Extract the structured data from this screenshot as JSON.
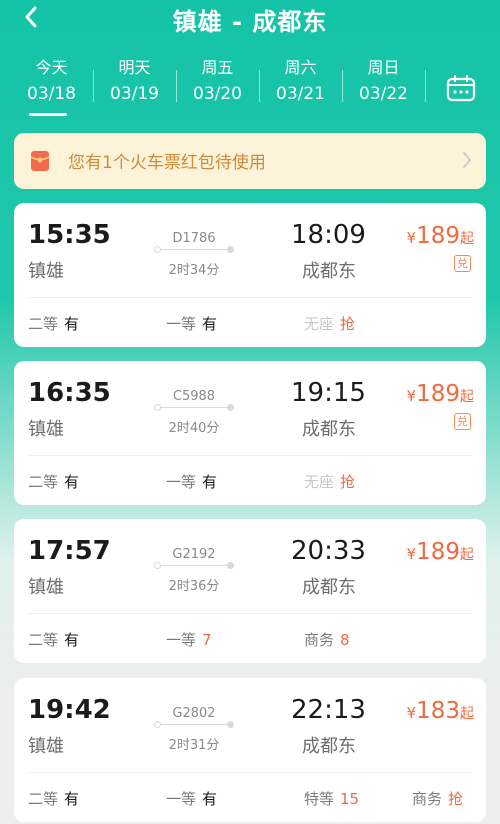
{
  "header": {
    "title": "镇雄 - 成都东",
    "back_icon": "chevron-left-icon",
    "calendar_icon": "calendar-icon"
  },
  "dates": [
    {
      "weekday": "今天",
      "date": "03/18",
      "selected": true
    },
    {
      "weekday": "明天",
      "date": "03/19",
      "selected": false
    },
    {
      "weekday": "周五",
      "date": "03/20",
      "selected": false
    },
    {
      "weekday": "周六",
      "date": "03/21",
      "selected": false
    },
    {
      "weekday": "周日",
      "date": "03/22",
      "selected": false
    }
  ],
  "promo": {
    "text": "您有1个火车票红包待使用",
    "icon": "red-packet-icon"
  },
  "trains": [
    {
      "dep_time": "15:35",
      "dep_station": "镇雄",
      "train_no": "D1786",
      "duration": "2时34分",
      "arr_time": "18:09",
      "arr_station": "成都东",
      "price_symbol": "¥",
      "price": "189",
      "price_suffix": "起",
      "badge": "兑",
      "seats": [
        {
          "label": "二等",
          "value": "有"
        },
        {
          "label": "一等",
          "value": "有"
        },
        {
          "label": "无座",
          "value": "抢"
        }
      ]
    },
    {
      "dep_time": "16:35",
      "dep_station": "镇雄",
      "train_no": "C5988",
      "duration": "2时40分",
      "arr_time": "19:15",
      "arr_station": "成都东",
      "price_symbol": "¥",
      "price": "189",
      "price_suffix": "起",
      "badge": "兑",
      "seats": [
        {
          "label": "二等",
          "value": "有"
        },
        {
          "label": "一等",
          "value": "有"
        },
        {
          "label": "无座",
          "value": "抢"
        }
      ]
    },
    {
      "dep_time": "17:57",
      "dep_station": "镇雄",
      "train_no": "G2192",
      "duration": "2时36分",
      "arr_time": "20:33",
      "arr_station": "成都东",
      "price_symbol": "¥",
      "price": "189",
      "price_suffix": "起",
      "badge": "",
      "seats": [
        {
          "label": "二等",
          "value": "有"
        },
        {
          "label": "一等",
          "value": "7"
        },
        {
          "label": "商务",
          "value": "8"
        }
      ]
    },
    {
      "dep_time": "19:42",
      "dep_station": "镇雄",
      "train_no": "G2802",
      "duration": "2时31分",
      "arr_time": "22:13",
      "arr_station": "成都东",
      "price_symbol": "¥",
      "price": "183",
      "price_suffix": "起",
      "badge": "",
      "seats": [
        {
          "label": "二等",
          "value": "有"
        },
        {
          "label": "一等",
          "value": "有"
        },
        {
          "label": "特等",
          "value": "15"
        },
        {
          "label": "商务",
          "value": "抢"
        }
      ]
    }
  ],
  "colors": {
    "brand_teal": "#14c3a6",
    "price_orange": "#f06a40",
    "promo_bg": "#fdf3d8",
    "promo_text": "#d08a3a"
  }
}
